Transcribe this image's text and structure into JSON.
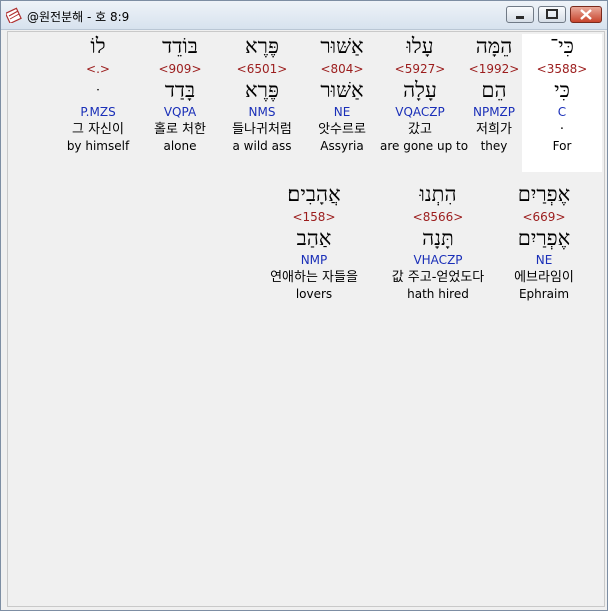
{
  "window": {
    "title": "@원전분해 - 호 8:9",
    "minimize_icon": "minimize-icon",
    "maximize_icon": "maximize-icon",
    "close_icon": "close-icon",
    "app_icon": "bible-book-icon"
  },
  "rows": [
    {
      "words": [
        {
          "heb": "כִּי־",
          "strong": "<3588>",
          "lemma": "כִּי",
          "morph": "C",
          "kor": "·",
          "eng": "For",
          "selected": true
        },
        {
          "heb": "הֵמָּה",
          "strong": "<1992>",
          "lemma": "הֵם",
          "morph": "NPMZP",
          "kor": "저희가",
          "eng": "they"
        },
        {
          "heb": "עָלוּ",
          "strong": "<5927>",
          "lemma": "עָלָה",
          "morph": "VQACZP",
          "kor": "갔고",
          "eng": "are gone up to"
        },
        {
          "heb": "אַשּׁוּר",
          "strong": "<804>",
          "lemma": "אַשּׁוּר",
          "morph": "NE",
          "kor": "앗수르로",
          "eng": "Assyria"
        },
        {
          "heb": "פֶּרֶא",
          "strong": "<6501>",
          "lemma": "פֶּרֶא",
          "morph": "NMS",
          "kor": "들나귀처럼",
          "eng": "a wild ass"
        },
        {
          "heb": "בּוֹדֵד",
          "strong": "<909>",
          "lemma": "בָּדַד",
          "morph": "VQPA",
          "kor": "홀로 처한",
          "eng": "alone"
        },
        {
          "heb": "לוֹ",
          "strong": "<.>",
          "lemma": "ּ",
          "morph": "P.MZS",
          "kor": "그 자신이",
          "eng": "by himself"
        }
      ]
    },
    {
      "words": [
        {
          "heb": "אֶפְרַיִם",
          "strong": "<669>",
          "lemma": "אֶפְרַיִם",
          "morph": "NE",
          "kor": "에브라임이",
          "eng": "Ephraim"
        },
        {
          "heb": "הִתְנוּ",
          "strong": "<8566>",
          "lemma": "תָּנָה",
          "morph": "VHACZP",
          "kor": "값 주고-얻었도다",
          "eng": "hath hired"
        },
        {
          "heb": "אֲהָבִים׃",
          "strong": "<158>",
          "lemma": "אַהַב",
          "morph": "NMP",
          "kor": "연애하는 자들을",
          "eng": "lovers"
        }
      ]
    }
  ]
}
